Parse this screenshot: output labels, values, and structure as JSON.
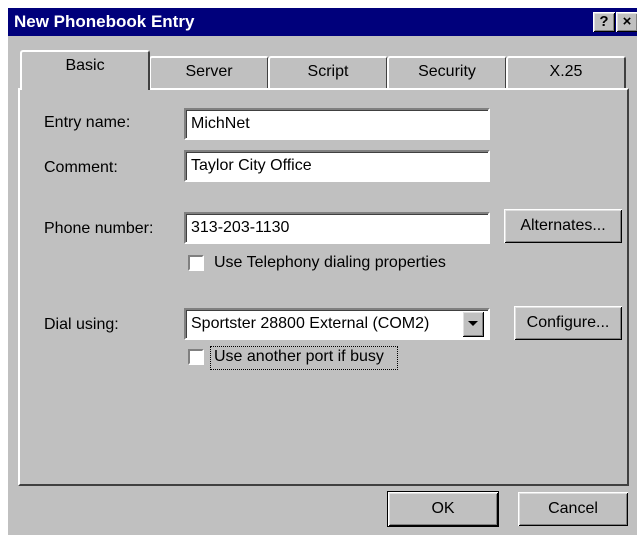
{
  "window": {
    "title": "New Phonebook Entry",
    "help_glyph": "?",
    "close_glyph": "×"
  },
  "tabs": [
    {
      "label": "Basic",
      "active": true
    },
    {
      "label": "Server",
      "active": false
    },
    {
      "label": "Script",
      "active": false
    },
    {
      "label": "Security",
      "active": false
    },
    {
      "label": "X.25",
      "active": false
    }
  ],
  "form": {
    "entry_name": {
      "label": "Entry name:",
      "value": "MichNet"
    },
    "comment": {
      "label": "Comment:",
      "value": "Taylor City Office"
    },
    "phone_number": {
      "label": "Phone number:",
      "value": "313-203-1130",
      "button": "Alternates..."
    },
    "use_telephony": {
      "label": "Use Telephony dialing properties",
      "checked": false
    },
    "dial_using": {
      "label": "Dial using:",
      "value": "Sportster 28800 External (COM2)",
      "button": "Configure..."
    },
    "use_another_port": {
      "label": "Use another port if busy",
      "checked": false
    }
  },
  "footer": {
    "ok_label": "OK",
    "cancel_label": "Cancel"
  },
  "colors": {
    "titlebar": "#00007b",
    "face": "#c0c0c0"
  },
  "icons": [
    "help-icon",
    "close-icon",
    "dropdown-arrow-icon"
  ]
}
